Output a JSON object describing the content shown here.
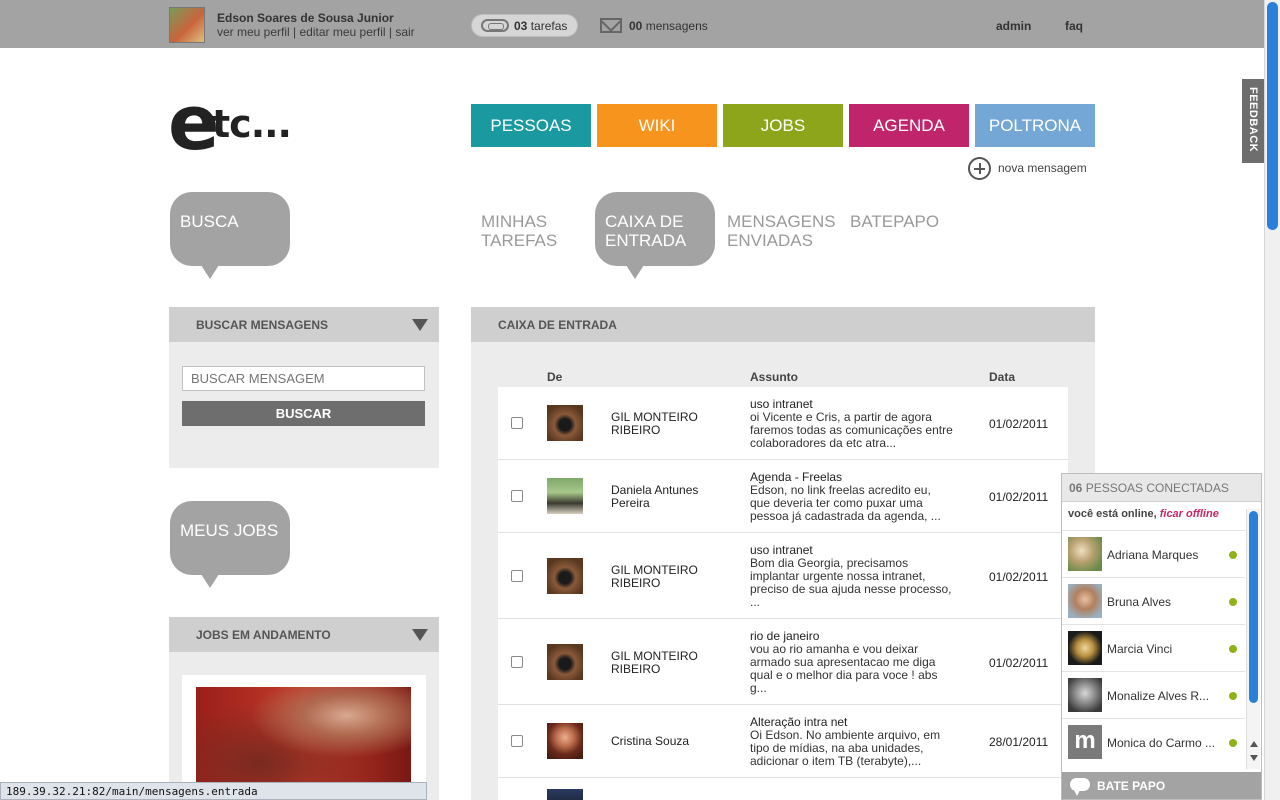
{
  "topbar": {
    "user_name": "Edson Soares de Sousa Junior",
    "user_links": [
      "ver meu perfil",
      "editar meu perfil",
      "sair"
    ],
    "separator": " | ",
    "tasks_count": "03",
    "tasks_label": "tarefas",
    "messages_count": "00",
    "messages_label": "mensagens",
    "admin": "admin",
    "faq": "faq"
  },
  "feedback": "FEEDBACK",
  "logo": {
    "e": "e",
    "tc": "tc..."
  },
  "nav": [
    {
      "label": "PESSOAS",
      "color": "#1a9aa0"
    },
    {
      "label": "WIKI",
      "color": "#f7941d"
    },
    {
      "label": "JOBS",
      "color": "#8da51b"
    },
    {
      "label": "AGENDA",
      "color": "#c0246a"
    },
    {
      "label": "POLTRONA",
      "color": "#74a7d5"
    }
  ],
  "new_message": "nova mensagem",
  "sidebar": {
    "busca_bubble": "BUSCA",
    "search_panel_title": "BUSCAR MENSAGENS",
    "search_placeholder": "BUSCAR MENSAGEM",
    "search_button": "BUSCAR",
    "jobs_bubble": "MEUS JOBS",
    "jobs_panel_title": "JOBS EM ANDAMENTO"
  },
  "subtabs": {
    "minhas_tarefas": [
      "MINHAS",
      "TAREFAS"
    ],
    "caixa_entrada": [
      "CAIXA DE",
      "ENTRADA"
    ],
    "mensagens_enviadas": [
      "MENSAGENS",
      "ENVIADAS"
    ],
    "batepapo": "BATEPAPO"
  },
  "inbox": {
    "title": "CAIXA DE ENTRADA",
    "columns": {
      "from": "De",
      "subject": "Assunto",
      "date": "Data"
    },
    "rows": [
      {
        "from": [
          "GIL MONTEIRO",
          "RIBEIRO"
        ],
        "subject": "uso intranet",
        "preview": [
          "oi Vicente e Cris, a partir de agora",
          "faremos todas as comunicações entre",
          "colaboradores da etc atra..."
        ],
        "date": "01/02/2011"
      },
      {
        "from": [
          "Daniela Antunes",
          "Pereira"
        ],
        "subject": "Agenda - Freelas",
        "preview": [
          "Edson, no link freelas acredito eu,",
          "que deveria ter como puxar uma",
          "pessoa já cadastrada da agenda, ..."
        ],
        "date": "01/02/2011"
      },
      {
        "from": [
          "GIL MONTEIRO",
          "RIBEIRO"
        ],
        "subject": "uso intranet",
        "preview": [
          "Bom dia Georgia, precisamos",
          "implantar urgente nossa intranet,",
          "preciso de sua ajuda nesse processo,",
          "..."
        ],
        "date": "01/02/2011"
      },
      {
        "from": [
          "GIL MONTEIRO",
          "RIBEIRO"
        ],
        "subject": "rio de janeiro",
        "preview": [
          "vou ao rio amanha e vou deixar",
          "armado sua apresentacao me diga",
          "qual e o melhor dia para voce ! abs",
          "g..."
        ],
        "date": "01/02/2011"
      },
      {
        "from": [
          "Cristina Souza"
        ],
        "subject": "Alteração intra net",
        "preview": [
          "Oi Edson. No ambiente arquivo, em",
          "tipo de mídias, na aba unidades,",
          "adicionar o item TB (terabyte),..."
        ],
        "date": "28/01/2011"
      }
    ]
  },
  "chat": {
    "count": "06",
    "title": "PESSOAS CONECTADAS",
    "status_text": "você está online,",
    "offline_link": "ficar offline",
    "contacts": [
      {
        "name": "Adriana Marques"
      },
      {
        "name": "Bruna Alves"
      },
      {
        "name": "Marcia Vinci"
      },
      {
        "name": "Monalize Alves R..."
      },
      {
        "name": "Monica do Carmo ..."
      }
    ],
    "footer": "BATE PAPO"
  },
  "statusbar": "189.39.32.21:82/main/mensagens.entrada"
}
